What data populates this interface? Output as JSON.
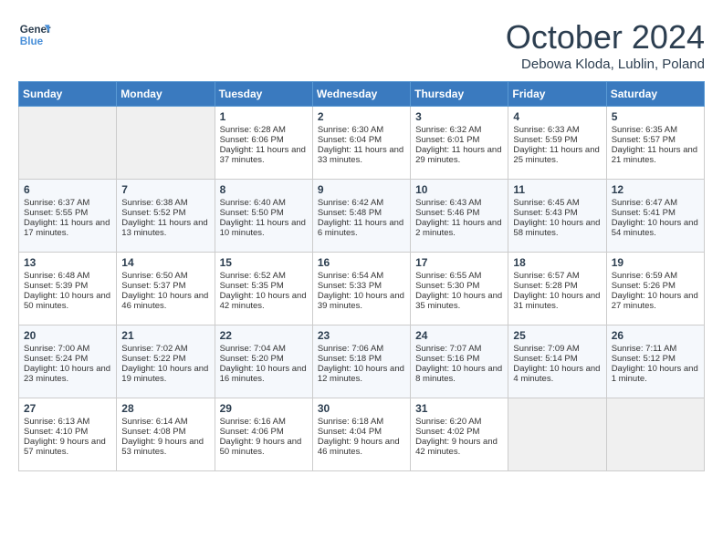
{
  "header": {
    "logo_line1": "General",
    "logo_line2": "Blue",
    "month": "October 2024",
    "location": "Debowa Kloda, Lublin, Poland"
  },
  "days_of_week": [
    "Sunday",
    "Monday",
    "Tuesday",
    "Wednesday",
    "Thursday",
    "Friday",
    "Saturday"
  ],
  "weeks": [
    [
      {
        "day": "",
        "empty": true
      },
      {
        "day": "",
        "empty": true
      },
      {
        "day": "1",
        "sunrise": "6:28 AM",
        "sunset": "6:06 PM",
        "daylight": "11 hours and 37 minutes."
      },
      {
        "day": "2",
        "sunrise": "6:30 AM",
        "sunset": "6:04 PM",
        "daylight": "11 hours and 33 minutes."
      },
      {
        "day": "3",
        "sunrise": "6:32 AM",
        "sunset": "6:01 PM",
        "daylight": "11 hours and 29 minutes."
      },
      {
        "day": "4",
        "sunrise": "6:33 AM",
        "sunset": "5:59 PM",
        "daylight": "11 hours and 25 minutes."
      },
      {
        "day": "5",
        "sunrise": "6:35 AM",
        "sunset": "5:57 PM",
        "daylight": "11 hours and 21 minutes."
      }
    ],
    [
      {
        "day": "6",
        "sunrise": "6:37 AM",
        "sunset": "5:55 PM",
        "daylight": "11 hours and 17 minutes."
      },
      {
        "day": "7",
        "sunrise": "6:38 AM",
        "sunset": "5:52 PM",
        "daylight": "11 hours and 13 minutes."
      },
      {
        "day": "8",
        "sunrise": "6:40 AM",
        "sunset": "5:50 PM",
        "daylight": "11 hours and 10 minutes."
      },
      {
        "day": "9",
        "sunrise": "6:42 AM",
        "sunset": "5:48 PM",
        "daylight": "11 hours and 6 minutes."
      },
      {
        "day": "10",
        "sunrise": "6:43 AM",
        "sunset": "5:46 PM",
        "daylight": "11 hours and 2 minutes."
      },
      {
        "day": "11",
        "sunrise": "6:45 AM",
        "sunset": "5:43 PM",
        "daylight": "10 hours and 58 minutes."
      },
      {
        "day": "12",
        "sunrise": "6:47 AM",
        "sunset": "5:41 PM",
        "daylight": "10 hours and 54 minutes."
      }
    ],
    [
      {
        "day": "13",
        "sunrise": "6:48 AM",
        "sunset": "5:39 PM",
        "daylight": "10 hours and 50 minutes."
      },
      {
        "day": "14",
        "sunrise": "6:50 AM",
        "sunset": "5:37 PM",
        "daylight": "10 hours and 46 minutes."
      },
      {
        "day": "15",
        "sunrise": "6:52 AM",
        "sunset": "5:35 PM",
        "daylight": "10 hours and 42 minutes."
      },
      {
        "day": "16",
        "sunrise": "6:54 AM",
        "sunset": "5:33 PM",
        "daylight": "10 hours and 39 minutes."
      },
      {
        "day": "17",
        "sunrise": "6:55 AM",
        "sunset": "5:30 PM",
        "daylight": "10 hours and 35 minutes."
      },
      {
        "day": "18",
        "sunrise": "6:57 AM",
        "sunset": "5:28 PM",
        "daylight": "10 hours and 31 minutes."
      },
      {
        "day": "19",
        "sunrise": "6:59 AM",
        "sunset": "5:26 PM",
        "daylight": "10 hours and 27 minutes."
      }
    ],
    [
      {
        "day": "20",
        "sunrise": "7:00 AM",
        "sunset": "5:24 PM",
        "daylight": "10 hours and 23 minutes."
      },
      {
        "day": "21",
        "sunrise": "7:02 AM",
        "sunset": "5:22 PM",
        "daylight": "10 hours and 19 minutes."
      },
      {
        "day": "22",
        "sunrise": "7:04 AM",
        "sunset": "5:20 PM",
        "daylight": "10 hours and 16 minutes."
      },
      {
        "day": "23",
        "sunrise": "7:06 AM",
        "sunset": "5:18 PM",
        "daylight": "10 hours and 12 minutes."
      },
      {
        "day": "24",
        "sunrise": "7:07 AM",
        "sunset": "5:16 PM",
        "daylight": "10 hours and 8 minutes."
      },
      {
        "day": "25",
        "sunrise": "7:09 AM",
        "sunset": "5:14 PM",
        "daylight": "10 hours and 4 minutes."
      },
      {
        "day": "26",
        "sunrise": "7:11 AM",
        "sunset": "5:12 PM",
        "daylight": "10 hours and 1 minute."
      }
    ],
    [
      {
        "day": "27",
        "sunrise": "6:13 AM",
        "sunset": "4:10 PM",
        "daylight": "9 hours and 57 minutes."
      },
      {
        "day": "28",
        "sunrise": "6:14 AM",
        "sunset": "4:08 PM",
        "daylight": "9 hours and 53 minutes."
      },
      {
        "day": "29",
        "sunrise": "6:16 AM",
        "sunset": "4:06 PM",
        "daylight": "9 hours and 50 minutes."
      },
      {
        "day": "30",
        "sunrise": "6:18 AM",
        "sunset": "4:04 PM",
        "daylight": "9 hours and 46 minutes."
      },
      {
        "day": "31",
        "sunrise": "6:20 AM",
        "sunset": "4:02 PM",
        "daylight": "9 hours and 42 minutes."
      },
      {
        "day": "",
        "empty": true
      },
      {
        "day": "",
        "empty": true
      }
    ]
  ],
  "labels": {
    "sunrise": "Sunrise:",
    "sunset": "Sunset:",
    "daylight": "Daylight:"
  }
}
